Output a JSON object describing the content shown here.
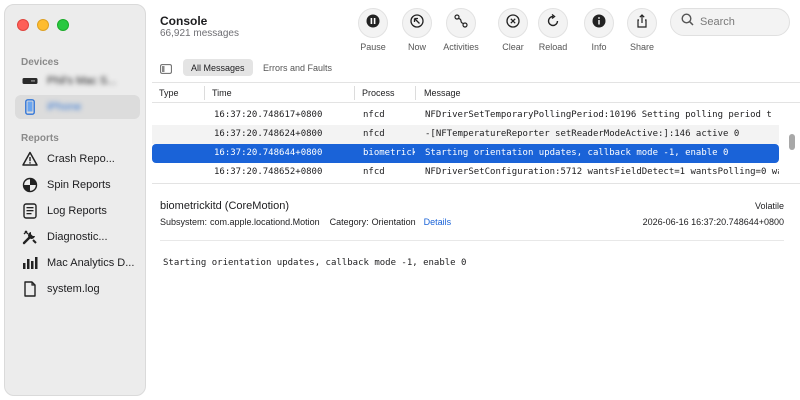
{
  "app": {
    "title": "Console",
    "subtitle": "66,921 messages"
  },
  "sidebar": {
    "devices_title": "Devices",
    "devices": [
      {
        "label": "Phil's Mac S...",
        "icon": "mac-mini-icon"
      },
      {
        "label": "iPhone",
        "icon": "iphone-icon"
      }
    ],
    "reports_title": "Reports",
    "reports": [
      {
        "label": "Crash Repo...",
        "icon": "crash-reports-icon"
      },
      {
        "label": "Spin Reports",
        "icon": "spin-reports-icon"
      },
      {
        "label": "Log Reports",
        "icon": "log-reports-icon"
      },
      {
        "label": "Diagnostic...",
        "icon": "diagnostic-reports-icon"
      },
      {
        "label": "Mac Analytics D...",
        "icon": "analytics-data-icon"
      },
      {
        "label": "system.log",
        "icon": "document-icon"
      }
    ]
  },
  "toolbar": {
    "pause": "Pause",
    "now": "Now",
    "activities": "Activities",
    "clear": "Clear",
    "reload": "Reload",
    "info": "Info",
    "share": "Share",
    "search_placeholder": "Search"
  },
  "filters": {
    "all": "All Messages",
    "errors": "Errors and Faults"
  },
  "table": {
    "columns": [
      "Type",
      "Time",
      "Process",
      "Message"
    ],
    "rows": [
      {
        "time": "16:37:20.748617+0800",
        "process": "nfcd",
        "message": "NFDriverSetTemporaryPollingPeriod:10196 Setting polling period t"
      },
      {
        "time": "16:37:20.748624+0800",
        "process": "nfcd",
        "message": "-[NFTemperatureReporter setReaderModeActive:]:146 active 0"
      },
      {
        "time": "16:37:20.748644+0800",
        "process": "biometrickitd",
        "message": "Starting orientation updates, callback mode -1, enable 0"
      },
      {
        "time": "16:37:20.748652+0800",
        "process": "nfcd",
        "message": "NFDriverSetConfiguration:5712 wantsFieldDetect=1 wantsPolling=0 wa"
      }
    ]
  },
  "detail": {
    "title": "biometrickitd (CoreMotion)",
    "volatile": "Volatile",
    "subsystem_label": "Subsystem:",
    "subsystem": "com.apple.locationd.Motion",
    "category_label": "Category:",
    "category": "Orientation",
    "details_link": "Details",
    "date": "2026-06-16 16:37:20.748644+0800",
    "message": "Starting orientation updates, callback mode -1, enable 0"
  },
  "colors": {
    "accent": "#1a63d8",
    "sidebar_bg": "#ececec"
  }
}
